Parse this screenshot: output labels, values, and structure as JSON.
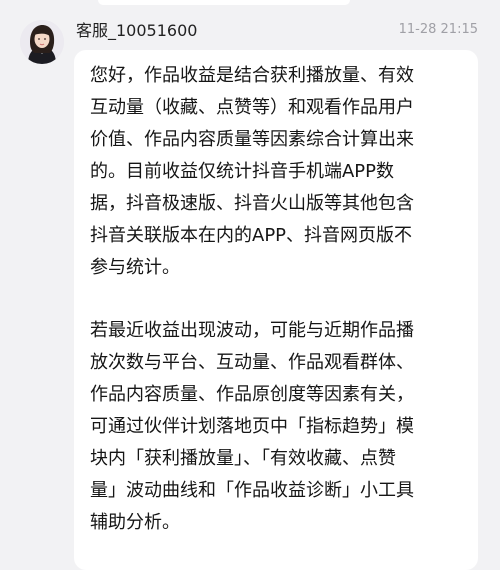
{
  "chat": {
    "sender_name": "客服_10051600",
    "timestamp": "11-28 21:15",
    "avatar_icon": "customer-service-avatar-icon",
    "message": {
      "paragraph1_lines": [
        "您好，作品收益是结合获利播放量、有效",
        "互动量（收藏、点赞等）和观看作品用户",
        "价值、作品内容质量等因素综合计算出来",
        "的。目前收益仅统计抖音手机端APP数",
        "据，抖音极速版、抖音火山版等其他包含",
        "抖音关联版本在内的APP、抖音网页版不",
        "参与统计。"
      ],
      "paragraph2_lines": [
        "若最近收益出现波动，可能与近期作品播",
        "放次数与平台、互动量、作品观看群体、",
        "作品内容质量、作品原创度等因素有关，",
        "可通过伙伴计划落地页中「指标趋势」模",
        "块内「获利播放量」、「有效收藏、点赞",
        "量」波动曲线和「作品收益诊断」小工具",
        "辅助分析。"
      ]
    }
  },
  "colors": {
    "background": "#f2f2f4",
    "bubble": "#ffffff",
    "text": "#161616",
    "timestamp": "#a0a0a6"
  }
}
